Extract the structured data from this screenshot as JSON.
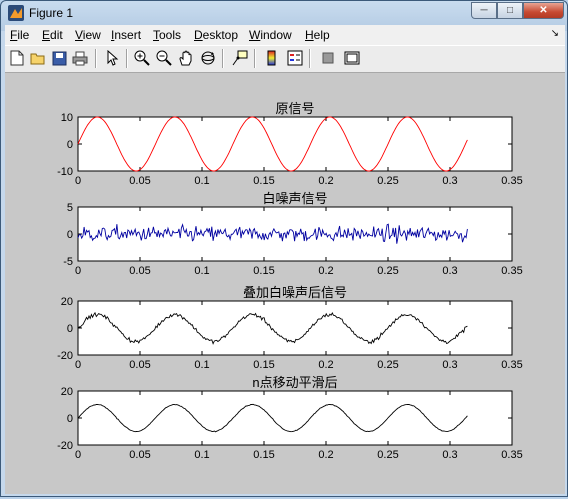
{
  "window": {
    "title": "Figure 1"
  },
  "menu": [
    "File",
    "Edit",
    "View",
    "Insert",
    "Tools",
    "Desktop",
    "Window",
    "Help"
  ],
  "menu_underline": [
    "F",
    "E",
    "V",
    "I",
    "T",
    "D",
    "W",
    "H"
  ],
  "toolbar_icons": [
    "new-file-icon",
    "open-folder-icon",
    "save-icon",
    "print-icon",
    "pointer-icon",
    "zoom-in-icon",
    "zoom-out-icon",
    "pan-hand-icon",
    "rotate-3d-icon",
    "data-cursor-icon",
    "colorbar-icon",
    "legend-icon",
    "hide-plot-tools-icon",
    "show-plot-tools-icon"
  ],
  "chart_data": [
    {
      "type": "line",
      "title": "原信号",
      "xlim": [
        0,
        0.35
      ],
      "ylim": [
        -10,
        10
      ],
      "xticks": [
        "0",
        "0.05",
        "0.1",
        "0.15",
        "0.2",
        "0.25",
        "0.3",
        "0.35"
      ],
      "yticks": [
        "10",
        "0",
        "-10"
      ],
      "color": "#ff0000",
      "signal": "sine",
      "amplitude": 10,
      "frequency_hz": 16,
      "x_range": [
        0,
        0.314
      ],
      "noise": 0
    },
    {
      "type": "line",
      "title": "白噪声信号",
      "xlim": [
        0,
        0.35
      ],
      "ylim": [
        -5,
        5
      ],
      "xticks": [
        "0",
        "0.05",
        "0.1",
        "0.15",
        "0.2",
        "0.25",
        "0.3",
        "0.35"
      ],
      "yticks": [
        "5",
        "0",
        "-5"
      ],
      "color": "#0000a0",
      "signal": "noise",
      "amplitude": 0,
      "frequency_hz": 0,
      "x_range": [
        0,
        0.314
      ],
      "noise": 1
    },
    {
      "type": "line",
      "title": "叠加白噪声后信号",
      "xlim": [
        0,
        0.35
      ],
      "ylim": [
        -20,
        20
      ],
      "xticks": [
        "0",
        "0.05",
        "0.1",
        "0.15",
        "0.2",
        "0.25",
        "0.3",
        "0.35"
      ],
      "yticks": [
        "20",
        "0",
        "-20"
      ],
      "color": "#000000",
      "signal": "sine+noise",
      "amplitude": 10,
      "frequency_hz": 16,
      "x_range": [
        0,
        0.314
      ],
      "noise": 1
    },
    {
      "type": "line",
      "title": "n点移动平滑后",
      "xlim": [
        0,
        0.35
      ],
      "ylim": [
        -20,
        20
      ],
      "xticks": [
        "0",
        "0.05",
        "0.1",
        "0.15",
        "0.2",
        "0.25",
        "0.3",
        "0.35"
      ],
      "yticks": [
        "20",
        "0",
        "-20"
      ],
      "color": "#000000",
      "signal": "smoothed",
      "amplitude": 10,
      "frequency_hz": 16,
      "x_range": [
        0,
        0.314
      ],
      "noise": 0.2
    }
  ]
}
